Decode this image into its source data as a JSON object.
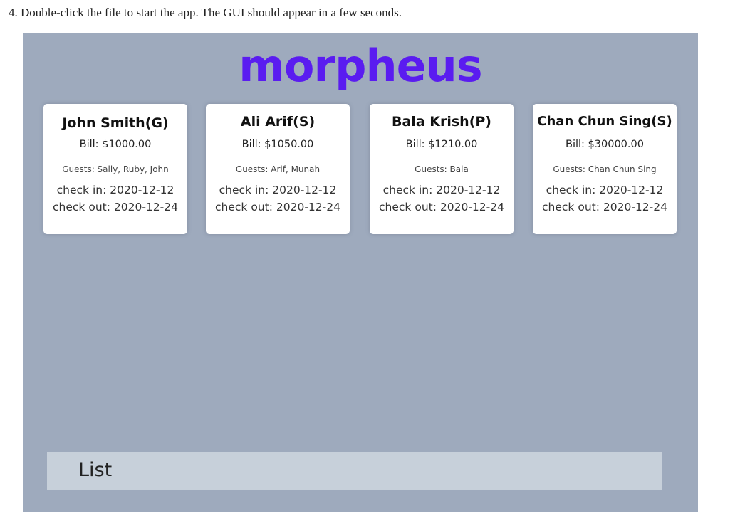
{
  "instruction": "4. Double-click the file to start the app. The GUI should appear in a few seconds.",
  "app": {
    "title": "morpheus",
    "colors": {
      "title": "#5a1cf0",
      "background": "#9eaabd",
      "card": "#ffffff",
      "list_bar": "#c7d0da"
    },
    "bookings": [
      {
        "name": "John Smith(G)",
        "bill": "Bill: $1000.00",
        "guests": "Guests: Sally, Ruby, John",
        "check_in": "check in: 2020-12-12",
        "check_out": "check out: 2020-12-24"
      },
      {
        "name": "Ali Arif(S)",
        "bill": "Bill: $1050.00",
        "guests": "Guests: Arif, Munah",
        "check_in": "check in: 2020-12-12",
        "check_out": "check out: 2020-12-24"
      },
      {
        "name": "Bala Krish(P)",
        "bill": "Bill: $1210.00",
        "guests": "Guests: Bala",
        "check_in": "check in: 2020-12-12",
        "check_out": "check out: 2020-12-24"
      },
      {
        "name": "Chan Chun Sing(S)",
        "bill": "Bill: $30000.00",
        "guests": "Guests: Chan Chun Sing",
        "check_in": "check in: 2020-12-12",
        "check_out": "check out: 2020-12-24"
      }
    ],
    "list_label": "List"
  }
}
